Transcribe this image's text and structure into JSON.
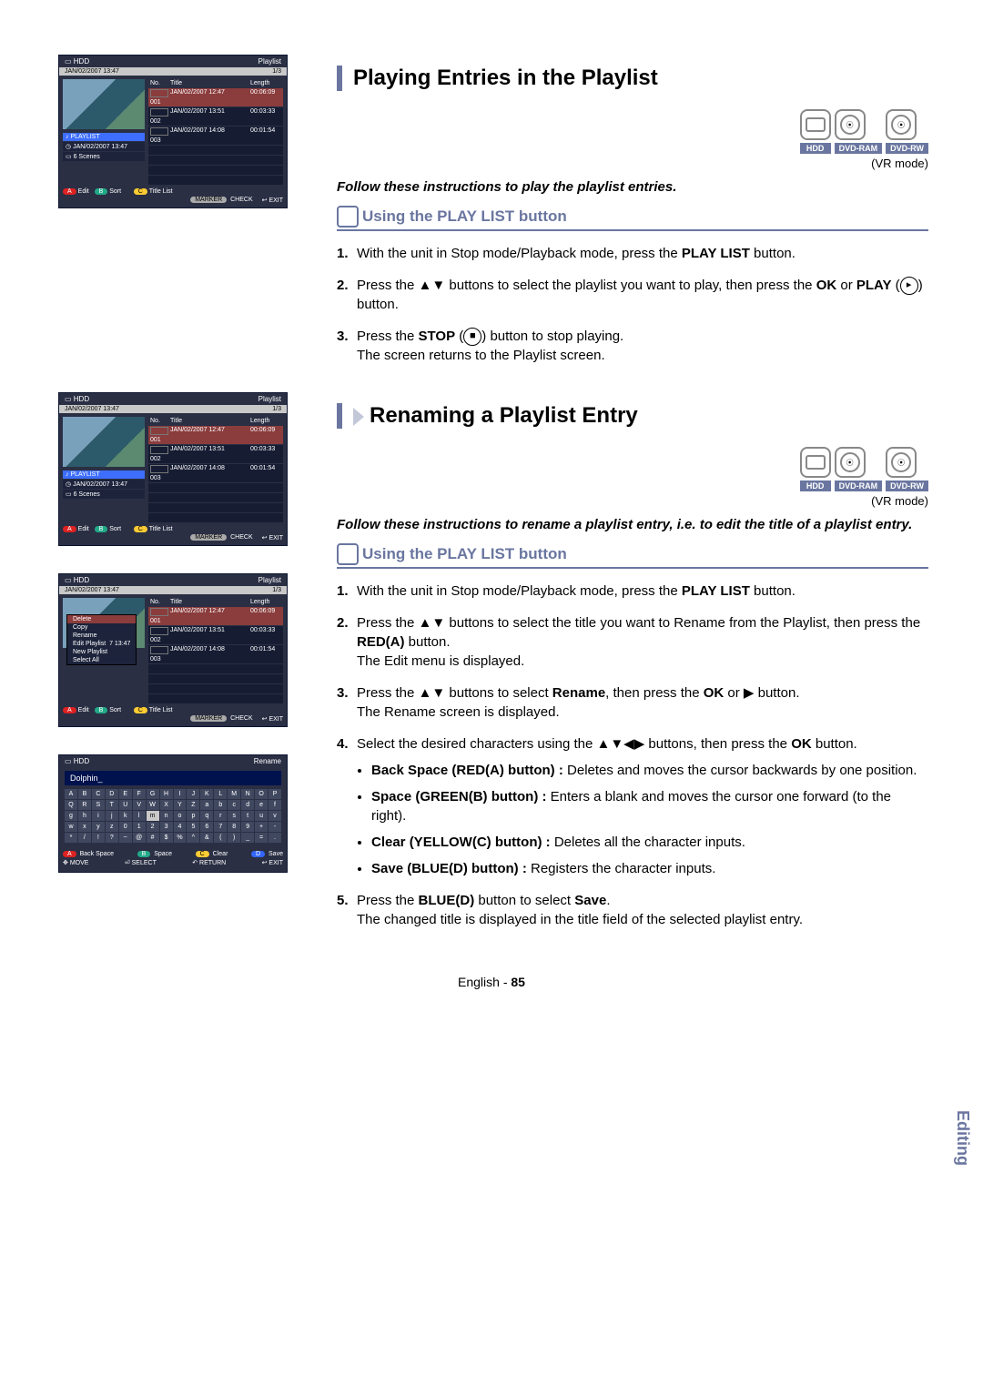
{
  "section1": {
    "title": "Playing Entries in the Playlist",
    "media": {
      "hdd": "HDD",
      "ram": "DVD-RAM",
      "rw": "DVD-RW",
      "vr": "(VR mode)"
    },
    "lead": "Follow these instructions to play the playlist entries.",
    "sub": "Using the PLAY LIST button",
    "steps": {
      "s1a": "With the unit in Stop mode/Playback mode, press the ",
      "s1b": "PLAY LIST",
      "s1c": " button.",
      "s2a": "Press the ▲▼ buttons to select the playlist you want to play, then press the ",
      "s2b": "OK",
      "s2c": " or ",
      "s2d": "PLAY",
      "s2e": " button.",
      "s3a": "Press the ",
      "s3b": "STOP",
      "s3c": " button to stop playing.",
      "s3d": "The screen returns to the Playlist screen."
    }
  },
  "section2": {
    "title": "Renaming a Playlist Entry",
    "media": {
      "hdd": "HDD",
      "ram": "DVD-RAM",
      "rw": "DVD-RW",
      "vr": "(VR mode)"
    },
    "lead": "Follow these instructions to rename a playlist entry, i.e. to edit the title of a playlist entry.",
    "sub": "Using the PLAY LIST button",
    "steps": {
      "s1a": "With the unit in Stop mode/Playback mode, press the ",
      "s1b": "PLAY LIST",
      "s1c": " button.",
      "s2a": "Press the ▲▼ buttons to select the title you want to Rename from the Playlist, then press the ",
      "s2b": "RED(A)",
      "s2c": " button.",
      "s2d": "The Edit menu is displayed.",
      "s3a": "Press the ▲▼ buttons to select ",
      "s3b": "Rename",
      "s3c": ", then press the ",
      "s3d": "OK",
      "s3e": " or ▶ button.",
      "s3f": "The Rename screen is displayed.",
      "s4a": "Select the desired characters using the ▲▼◀▶ buttons, then press the ",
      "s4b": "OK",
      "s4c": " button.",
      "b1a": "Back Space (RED(A) button) : ",
      "b1b": "Deletes and moves the cursor backwards by one position.",
      "b2a": "Space (GREEN(B) button) : ",
      "b2b": "Enters a blank and moves the cursor one forward (to the right).",
      "b3a": "Clear (YELLOW(C) button) : ",
      "b3b": "Deletes all the character inputs.",
      "b4a": "Save (BLUE(D) button) : ",
      "b4b": "Registers the character inputs.",
      "s5a": "Press the ",
      "s5b": "BLUE(D)",
      "s5c": " button to select ",
      "s5d": "Save",
      "s5e": ".",
      "s5f": "The changed title is displayed in the title field of the selected playlist entry."
    }
  },
  "osd": {
    "hdd": "HDD",
    "playlist": "Playlist",
    "subDate": "JAN/02/2007 13:47",
    "subPage": "1/3",
    "cols": {
      "no": "No.",
      "title": "Title",
      "length": "Length"
    },
    "rows": [
      {
        "no": "001",
        "title": "JAN/02/2007 12:47",
        "len": "00:06:09"
      },
      {
        "no": "002",
        "title": "JAN/02/2007 13:51",
        "len": "00:03:33"
      },
      {
        "no": "003",
        "title": "JAN/02/2007 14:08",
        "len": "00:01:54"
      }
    ],
    "side": {
      "playlist": "PLAYLIST",
      "date": "JAN/02/2007 13:47",
      "scenes": "6 Scenes",
      "date2": "7 13:47"
    },
    "foot": {
      "edit": "Edit",
      "sort": "Sort",
      "titlelist": "Title List",
      "marker": "MARKER",
      "check": "CHECK",
      "exit": "EXIT"
    },
    "ctx": [
      "Delete",
      "Copy",
      "Rename",
      "Edit Playlist",
      "New Playlist",
      "Select All"
    ],
    "rename": {
      "title": "Rename",
      "name": "Dolphin_",
      "foot": {
        "back": "Back Space",
        "space": "Space",
        "clear": "Clear",
        "save": "Save",
        "move": "MOVE",
        "select": "SELECT",
        "return": "RETURN",
        "exit": "EXIT"
      }
    }
  },
  "sideTab": "Editing",
  "footer": {
    "lang": "English",
    "page": "85"
  }
}
